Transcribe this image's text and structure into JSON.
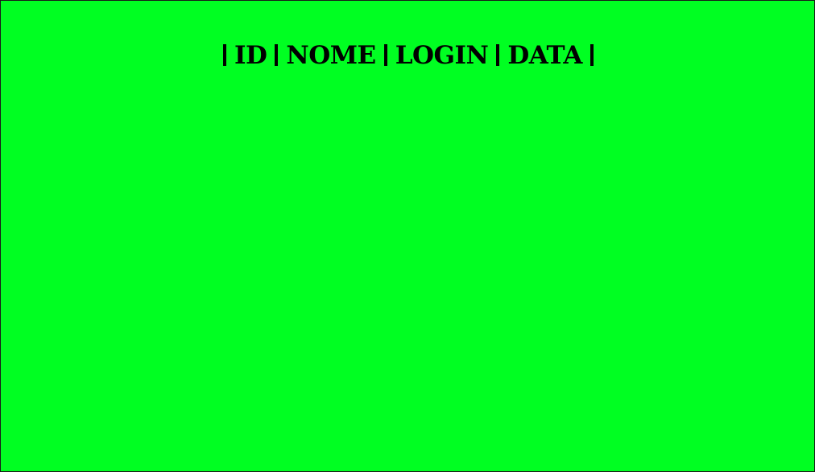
{
  "header": {
    "columns": [
      "ID",
      "NOME",
      "LOGIN",
      "DATA"
    ],
    "separator": "|"
  },
  "colors": {
    "background": "#00ff22",
    "text": "#000000"
  }
}
